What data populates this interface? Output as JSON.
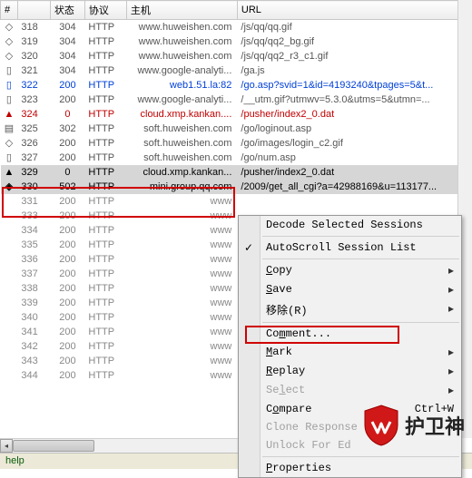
{
  "columns": {
    "icon": "#",
    "status": "状态",
    "proto": "协议",
    "host": "主机",
    "url": "URL"
  },
  "rows": [
    {
      "i": "◇",
      "n": "318",
      "s": "304",
      "p": "HTTP",
      "h": "www.huweishen.com",
      "u": "/js/qq/qq.gif",
      "cls": ""
    },
    {
      "i": "◇",
      "n": "319",
      "s": "304",
      "p": "HTTP",
      "h": "www.huweishen.com",
      "u": "/js/qq/qq2_bg.gif",
      "cls": ""
    },
    {
      "i": "◇",
      "n": "320",
      "s": "304",
      "p": "HTTP",
      "h": "www.huweishen.com",
      "u": "/js/qq/qq2_r3_c1.gif",
      "cls": ""
    },
    {
      "i": "▯",
      "n": "321",
      "s": "304",
      "p": "HTTP",
      "h": "www.google-analyti...",
      "u": "/ga.js",
      "cls": ""
    },
    {
      "i": "▯",
      "n": "322",
      "s": "200",
      "p": "HTTP",
      "h": "web1.51.la:82",
      "u": "/go.asp?svid=1&id=4193240&tpages=5&t...",
      "cls": "blue"
    },
    {
      "i": "▯",
      "n": "323",
      "s": "200",
      "p": "HTTP",
      "h": "www.google-analyti...",
      "u": "/__utm.gif?utmwv=5.3.0&utms=5&utmn=...",
      "cls": ""
    },
    {
      "i": "▲",
      "n": "324",
      "s": "0",
      "p": "HTTP",
      "h": "cloud.xmp.kankan....",
      "u": "/pusher/index2_0.dat",
      "cls": "red"
    },
    {
      "i": "▤",
      "n": "325",
      "s": "302",
      "p": "HTTP",
      "h": "soft.huweishen.com",
      "u": "/go/loginout.asp",
      "cls": ""
    },
    {
      "i": "◇",
      "n": "326",
      "s": "200",
      "p": "HTTP",
      "h": "soft.huweishen.com",
      "u": "/go/images/login_c2.gif",
      "cls": ""
    },
    {
      "i": "▯",
      "n": "327",
      "s": "200",
      "p": "HTTP",
      "h": "soft.huweishen.com",
      "u": "/go/num.asp",
      "cls": ""
    },
    {
      "i": "▲",
      "n": "329",
      "s": "0",
      "p": "HTTP",
      "h": "cloud.xmp.kankan...",
      "u": "/pusher/index2_0.dat",
      "cls": "sel"
    },
    {
      "i": "◈",
      "n": "330",
      "s": "502",
      "p": "HTTP",
      "h": "mini.group.qq.com",
      "u": "/2009/get_all_cgi?a=42988169&u=113177...",
      "cls": "sel"
    },
    {
      "i": "",
      "n": "331",
      "s": "200",
      "p": "HTTP",
      "h": "www",
      "u": "",
      "cls": "dim"
    },
    {
      "i": "",
      "n": "333",
      "s": "200",
      "p": "HTTP",
      "h": "www",
      "u": "",
      "cls": "dim"
    },
    {
      "i": "",
      "n": "334",
      "s": "200",
      "p": "HTTP",
      "h": "www",
      "u": "",
      "cls": "dim"
    },
    {
      "i": "",
      "n": "335",
      "s": "200",
      "p": "HTTP",
      "h": "www",
      "u": "",
      "cls": "dim"
    },
    {
      "i": "",
      "n": "336",
      "s": "200",
      "p": "HTTP",
      "h": "www",
      "u": "",
      "cls": "dim"
    },
    {
      "i": "",
      "n": "337",
      "s": "200",
      "p": "HTTP",
      "h": "www",
      "u": "",
      "cls": "dim"
    },
    {
      "i": "",
      "n": "338",
      "s": "200",
      "p": "HTTP",
      "h": "www",
      "u": "",
      "cls": "dim"
    },
    {
      "i": "",
      "n": "339",
      "s": "200",
      "p": "HTTP",
      "h": "www",
      "u": "",
      "cls": "dim"
    },
    {
      "i": "",
      "n": "340",
      "s": "200",
      "p": "HTTP",
      "h": "www",
      "u": "",
      "cls": "dim"
    },
    {
      "i": "",
      "n": "341",
      "s": "200",
      "p": "HTTP",
      "h": "www",
      "u": "",
      "cls": "dim"
    },
    {
      "i": "",
      "n": "342",
      "s": "200",
      "p": "HTTP",
      "h": "www",
      "u": "",
      "cls": "dim"
    },
    {
      "i": "",
      "n": "343",
      "s": "200",
      "p": "HTTP",
      "h": "www",
      "u": "",
      "cls": "dim"
    },
    {
      "i": "",
      "n": "344",
      "s": "200",
      "p": "HTTP",
      "h": "www",
      "u": "",
      "cls": "dim"
    }
  ],
  "menu": {
    "decode": "Decode Selected Sessions",
    "autoscroll": "AutoScroll Session List",
    "copy": "Copy",
    "save": "Save",
    "remove": "移除(R)",
    "comment": "Comment...",
    "mark": "Mark",
    "replay": "Replay",
    "select": "Select",
    "compare": "Compare",
    "compare_sc": "Ctrl+W",
    "clone": "Clone Response",
    "unlock": "Unlock For Ed",
    "properties": "Properties"
  },
  "logo_text": "护卫神",
  "status_text": "help"
}
